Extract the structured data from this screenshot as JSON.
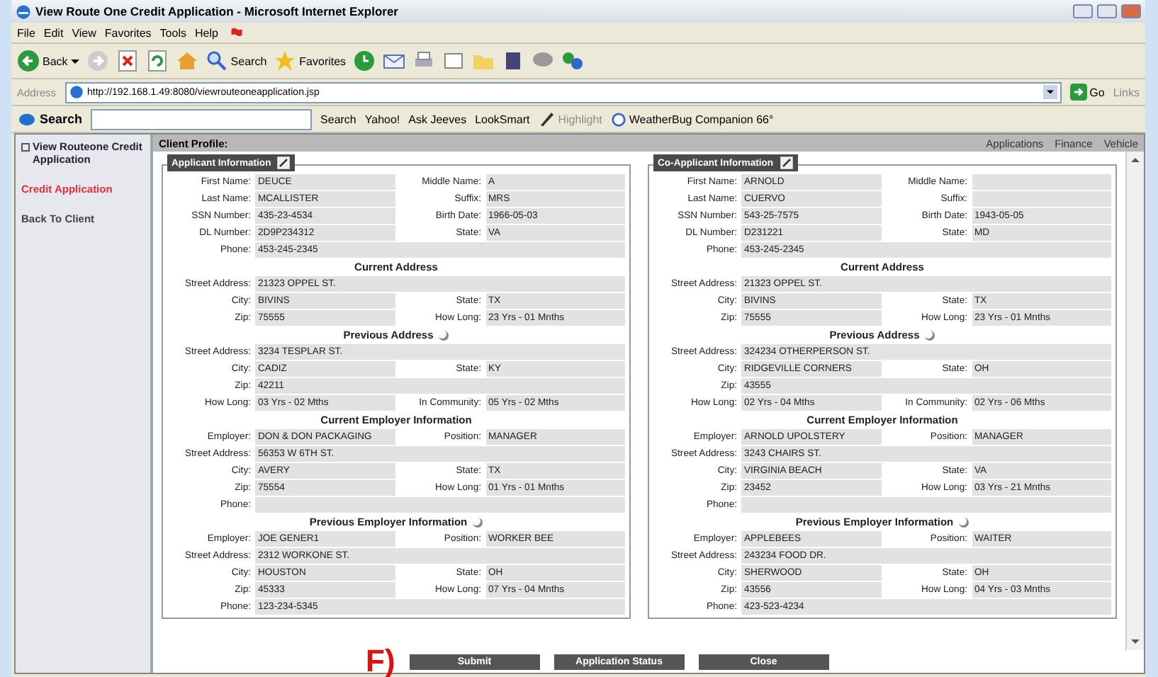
{
  "window": {
    "title": "View Route One Credit Application - Microsoft Internet Explorer"
  },
  "menu": [
    "File",
    "Edit",
    "View",
    "Favorites",
    "Tools",
    "Help"
  ],
  "toolbar_buttons": [
    "Back",
    "Search",
    "Favorites"
  ],
  "address_bar": {
    "label": "Address",
    "url": "http://192.168.1.49:8080/viewrouteoneapplication.jsp",
    "go": "Go",
    "links": "Links"
  },
  "search_bar": {
    "logo": "Search",
    "buttons": [
      "Search",
      "Yahoo!",
      "Ask Jeeves",
      "LookSmart"
    ],
    "highlight": {
      "label": "Highlight",
      "disabled": true
    },
    "weather": "WeatherBug Companion 66°"
  },
  "sidebar": {
    "heading": "View Routeone Credit Application",
    "items": [
      {
        "label": "Credit Application",
        "selected": true
      },
      {
        "label": "Back To Client",
        "selected": false
      }
    ]
  },
  "header": {
    "title": "Client Profile:",
    "links": [
      "Applications",
      "Finance",
      "Vehicle"
    ]
  },
  "panels": [
    {
      "title": "Applicant Information",
      "rows": [
        {
          "kind": "pair",
          "label": "First Name:",
          "value": "DEUCE",
          "label2": "Middle Name:",
          "value2": "A"
        },
        {
          "kind": "pair",
          "label": "Last Name:",
          "value": "MCALLISTER",
          "label2": "Suffix:",
          "value2": "MRS"
        },
        {
          "kind": "pair",
          "label": "SSN Number:",
          "value": "435-23-4534",
          "label2": "Birth Date:",
          "value2": "1966-05-03"
        },
        {
          "kind": "pair",
          "label": "DL Number:",
          "value": "2D9P234312",
          "label2": "State:",
          "value2": "VA"
        },
        {
          "kind": "single",
          "label": "Phone:",
          "value": "453-245-2345"
        },
        {
          "kind": "heading",
          "label": "Current Address"
        },
        {
          "kind": "single",
          "label": "Street Address:",
          "value": "21323 OPPEL ST."
        },
        {
          "kind": "pair",
          "label": "City:",
          "value": "BIVINS",
          "label2": "State:",
          "value2": "TX"
        },
        {
          "kind": "pair",
          "label": "Zip:",
          "value": "75555",
          "label2": "How Long:",
          "value2": "23 Yrs - 01 Mnths"
        },
        {
          "kind": "heading",
          "label": "Previous Address",
          "icon": true
        },
        {
          "kind": "single",
          "label": "Street Address:",
          "value": "3234 TESPLAR ST."
        },
        {
          "kind": "pair",
          "label": "City:",
          "value": "CADIZ",
          "label2": "State:",
          "value2": "KY"
        },
        {
          "kind": "single",
          "label": "Zip:",
          "value": "42211"
        },
        {
          "kind": "pair",
          "label": "How Long:",
          "value": "03 Yrs - 02 Mths",
          "label2": "In Community:",
          "value2": "05 Yrs - 02 Mths"
        },
        {
          "kind": "heading",
          "label": "Current Employer Information"
        },
        {
          "kind": "pair",
          "label": "Employer:",
          "value": "DON & DON PACKAGING",
          "label2": "Position:",
          "value2": "MANAGER"
        },
        {
          "kind": "single",
          "label": "Street Address:",
          "value": "56353 W 6TH ST."
        },
        {
          "kind": "pair",
          "label": "City:",
          "value": "AVERY",
          "label2": "State:",
          "value2": "TX"
        },
        {
          "kind": "pair",
          "label": "Zip:",
          "value": "75554",
          "label2": "How Long:",
          "value2": "01 Yrs - 01 Mnths"
        },
        {
          "kind": "single",
          "label": "Phone:"
        },
        {
          "kind": "heading",
          "label": "Previous Employer Information",
          "icon": true
        },
        {
          "kind": "pair",
          "label": "Employer:",
          "value": "JOE GENER1",
          "label2": "Position:",
          "value2": "WORKER BEE"
        },
        {
          "kind": "single",
          "label": "Street Address:",
          "value": "2312 WORKONE ST."
        },
        {
          "kind": "pair",
          "label": "City:",
          "value": "HOUSTON",
          "label2": "State:",
          "value2": "OH"
        },
        {
          "kind": "pair",
          "label": "Zip:",
          "value": "45333",
          "label2": "How Long:",
          "value2": "07 Yrs - 04 Mnths"
        },
        {
          "kind": "single",
          "label": "Phone:",
          "value": "123-234-5345"
        }
      ]
    },
    {
      "title": "Co-Applicant Information",
      "rows": [
        {
          "kind": "pair",
          "label": "First Name:",
          "value": "ARNOLD",
          "label2": "Middle Name:"
        },
        {
          "kind": "pair",
          "label": "Last Name:",
          "value": "CUERVO",
          "label2": "Suffix:"
        },
        {
          "kind": "pair",
          "label": "SSN Number:",
          "value": "543-25-7575",
          "label2": "Birth Date:",
          "value2": "1943-05-05"
        },
        {
          "kind": "pair",
          "label": "DL Number:",
          "value": "D231221",
          "label2": "State:",
          "value2": "MD"
        },
        {
          "kind": "single",
          "label": "Phone:",
          "value": "453-245-2345"
        },
        {
          "kind": "heading",
          "label": "Current Address"
        },
        {
          "kind": "single",
          "label": "Street Address:",
          "value": "21323 OPPEL ST."
        },
        {
          "kind": "pair",
          "label": "City:",
          "value": "BIVINS",
          "label2": "State:",
          "value2": "TX"
        },
        {
          "kind": "pair",
          "label": "Zip:",
          "value": "75555",
          "label2": "How Long:",
          "value2": "23 Yrs - 01 Mnths"
        },
        {
          "kind": "heading",
          "label": "Previous Address",
          "icon": true
        },
        {
          "kind": "single",
          "label": "Street Address:",
          "value": "324234 OTHERPERSON ST."
        },
        {
          "kind": "pair",
          "label": "City:",
          "value": "RIDGEVILLE CORNERS",
          "label2": "State:",
          "value2": "OH"
        },
        {
          "kind": "single",
          "label": "Zip:",
          "value": "43555"
        },
        {
          "kind": "pair",
          "label": "How Long:",
          "value": "02 Yrs - 04 Mths",
          "label2": "In Community:",
          "value2": "02 Yrs - 06 Mths"
        },
        {
          "kind": "heading",
          "label": "Current Employer Information"
        },
        {
          "kind": "pair",
          "label": "Employer:",
          "value": "ARNOLD UPOLSTERY",
          "label2": "Position:",
          "value2": "MANAGER"
        },
        {
          "kind": "single",
          "label": "Street Address:",
          "value": "3243 CHAIRS ST."
        },
        {
          "kind": "pair",
          "label": "City:",
          "value": "VIRGINIA BEACH",
          "label2": "State:",
          "value2": "VA"
        },
        {
          "kind": "pair",
          "label": "Zip:",
          "value": "23452",
          "label2": "How Long:",
          "value2": "03 Yrs - 21 Mnths"
        },
        {
          "kind": "single",
          "label": "Phone:"
        },
        {
          "kind": "heading",
          "label": "Previous Employer Information",
          "icon": true
        },
        {
          "kind": "pair",
          "label": "Employer:",
          "value": "APPLEBEES",
          "label2": "Position:",
          "value2": "WAITER"
        },
        {
          "kind": "single",
          "label": "Street Address:",
          "value": "243234 FOOD DR."
        },
        {
          "kind": "pair",
          "label": "City:",
          "value": "SHERWOOD",
          "label2": "State:",
          "value2": "OH"
        },
        {
          "kind": "pair",
          "label": "Zip:",
          "value": "43556",
          "label2": "How Long:",
          "value2": "04 Yrs - 03 Mnths"
        },
        {
          "kind": "single",
          "label": "Phone:",
          "value": "423-523-4234"
        }
      ]
    }
  ],
  "buttons": [
    "Submit",
    "Application Status",
    "Close"
  ],
  "annotation": "F)"
}
